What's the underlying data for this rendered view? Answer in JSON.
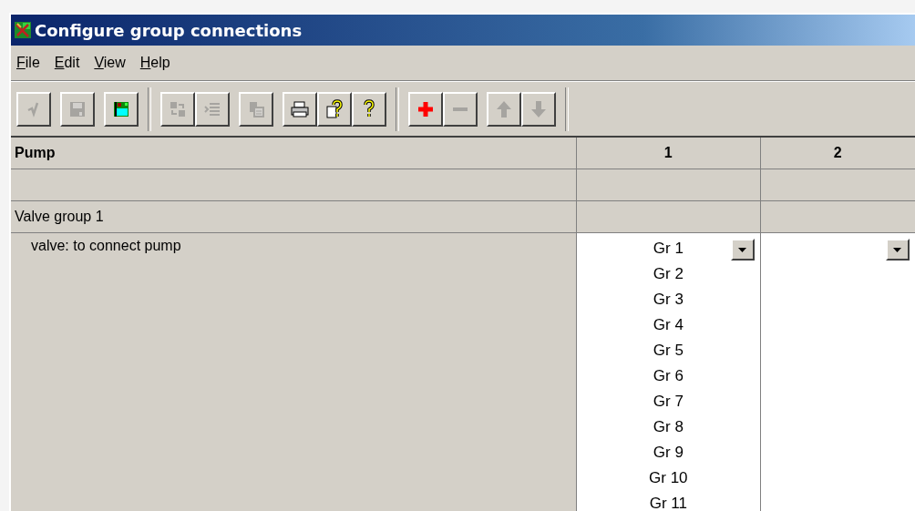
{
  "window": {
    "title": "Configure group connections"
  },
  "menu": [
    {
      "label": "File"
    },
    {
      "label": "Edit"
    },
    {
      "label": "View"
    },
    {
      "label": "Help"
    }
  ],
  "toolbar": [
    [
      {
        "kind": "check",
        "disabled": true
      }
    ],
    [
      {
        "kind": "save",
        "disabled": true
      }
    ],
    [
      {
        "kind": "screen",
        "disabled": false
      }
    ],
    [
      {
        "kind": "swap",
        "disabled": true
      },
      {
        "kind": "list",
        "disabled": true
      }
    ],
    [
      {
        "kind": "paste",
        "disabled": true
      }
    ],
    [
      {
        "kind": "print",
        "disabled": false
      },
      {
        "kind": "doc-help",
        "disabled": false
      },
      {
        "kind": "help",
        "disabled": false
      }
    ],
    [
      {
        "kind": "add",
        "disabled": false
      },
      {
        "kind": "remove",
        "disabled": true
      }
    ],
    [
      {
        "kind": "up",
        "disabled": true
      },
      {
        "kind": "down",
        "disabled": true
      }
    ]
  ],
  "table": {
    "columns": [
      "Pump",
      "1",
      "2"
    ],
    "rows": [
      {
        "kind": "blank"
      },
      {
        "kind": "group",
        "label": "Valve group 1"
      },
      {
        "kind": "select",
        "label": "valve: to connect pump",
        "cells": [
          {
            "kind": "open-list",
            "items": [
              "Gr 1",
              "Gr 2",
              "Gr 3",
              "Gr 4",
              "Gr 5",
              "Gr 6",
              "Gr 7",
              "Gr 8",
              "Gr 9",
              "Gr 10",
              "Gr 11"
            ]
          },
          {
            "kind": "empty-list"
          }
        ]
      }
    ]
  }
}
